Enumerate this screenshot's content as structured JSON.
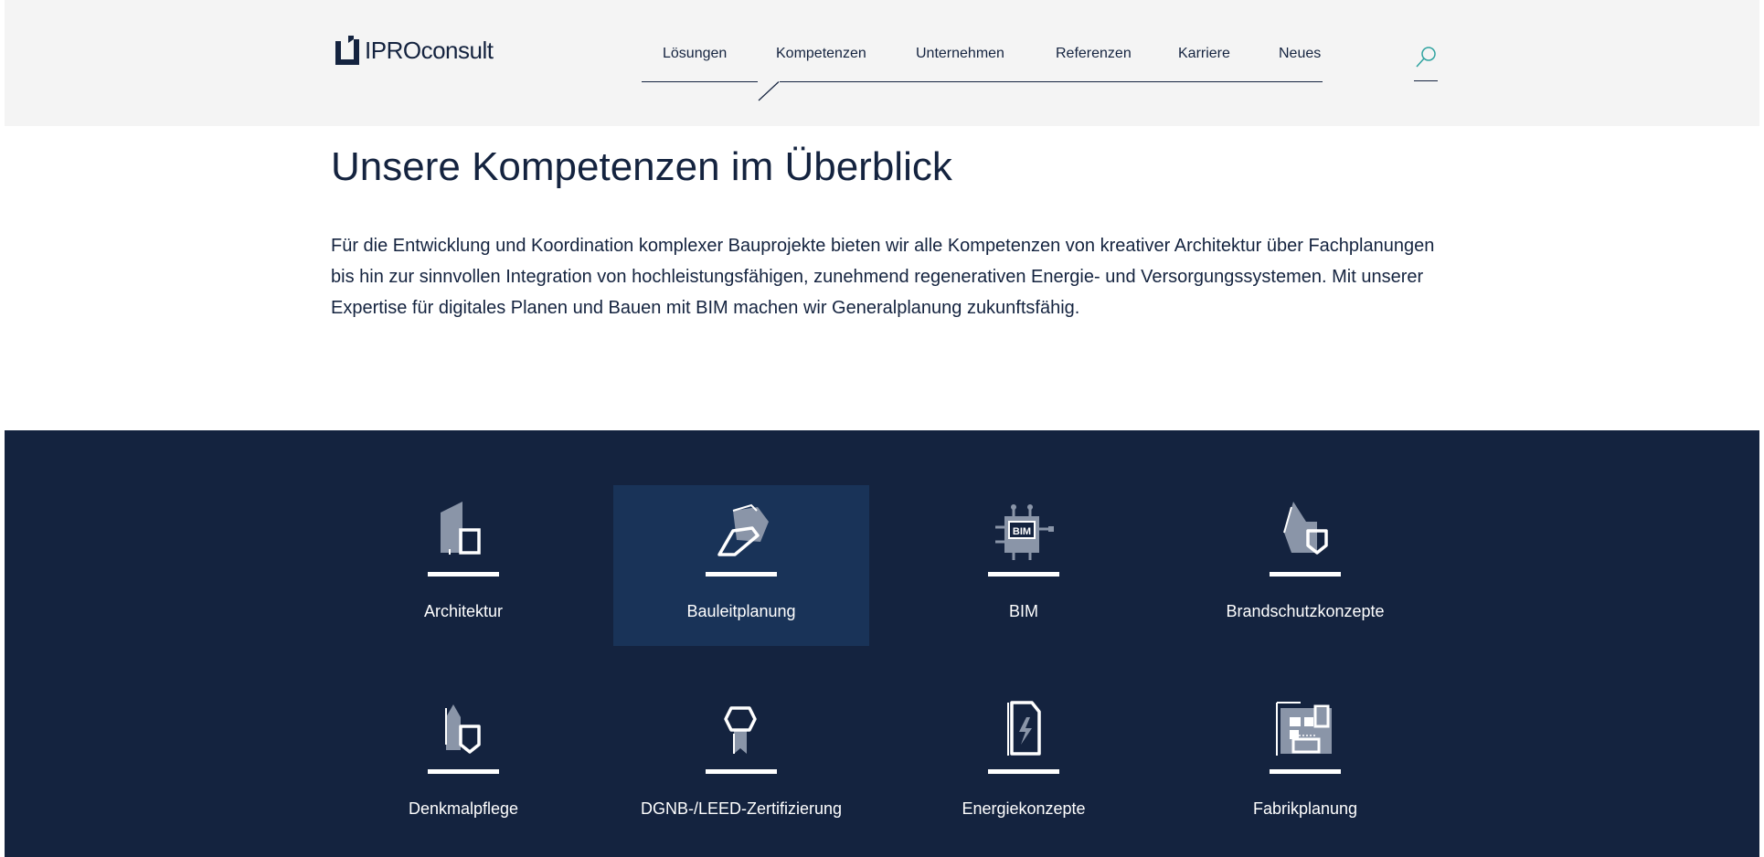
{
  "header": {
    "logo_text": "IPROconsult",
    "nav": [
      {
        "label": "Lösungen"
      },
      {
        "label": "Kompetenzen"
      },
      {
        "label": "Unternehmen"
      },
      {
        "label": "Referenzen"
      },
      {
        "label": "Karriere"
      },
      {
        "label": "Neues"
      }
    ],
    "active_nav": "Kompetenzen",
    "search_icon": "search-icon"
  },
  "main": {
    "title": "Unsere Kompetenzen im Überblick",
    "intro": "Für die Entwicklung und Koordination komplexer Bauprojekte bieten wir alle Kompetenzen von kreativer Architektur über Fachplanungen bis hin zur sinnvollen Integration von hochleistungsfähigen, zunehmend regenerativen Energie- und Versorgungssystemen. Mit unserer Expertise für digitales Planen und Bauen mit BIM machen wir Generalplanung zukunftsfähig."
  },
  "competences": [
    {
      "label": "Architektur",
      "icon": "architecture-icon"
    },
    {
      "label": "Bauleitplanung",
      "icon": "urban-planning-icon",
      "active": true
    },
    {
      "label": "BIM",
      "icon": "bim-icon",
      "badge": "BIM"
    },
    {
      "label": "Brandschutzkonzepte",
      "icon": "fire-protection-icon"
    },
    {
      "label": "Denkmalpflege",
      "icon": "monument-icon"
    },
    {
      "label": "DGNB-/LEED-Zertifizierung",
      "icon": "certification-icon"
    },
    {
      "label": "Energiekonzepte",
      "icon": "energy-icon"
    },
    {
      "label": "Fabrikplanung",
      "icon": "factory-planning-icon"
    }
  ],
  "colors": {
    "navy": "#14233f",
    "active_tile": "#193358",
    "header_bg": "#f4f4f4",
    "icon_grey": "#8a95a8",
    "accent": "#2fa3a0"
  }
}
